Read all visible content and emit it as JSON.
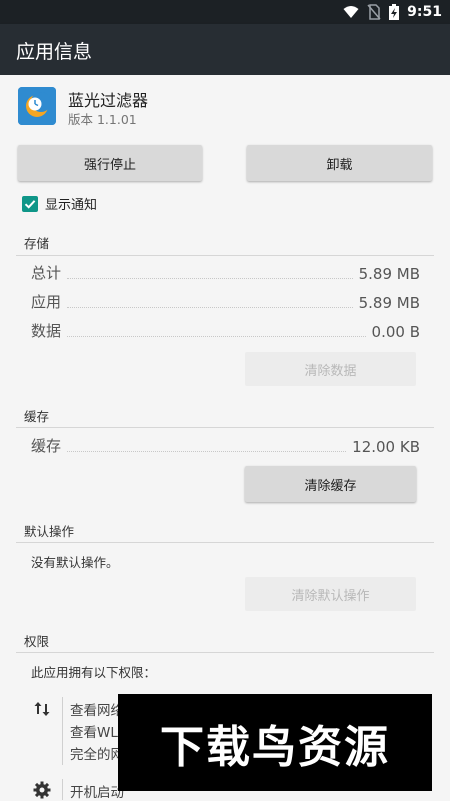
{
  "status_bar": {
    "time": "9:51",
    "icons": [
      "wifi-icon",
      "no-sim-icon",
      "battery-charging-icon"
    ]
  },
  "app_bar": {
    "title": "应用信息"
  },
  "app": {
    "name": "蓝光过滤器",
    "version": "版本 1.1.01",
    "icon": "blue-light-filter-app-icon"
  },
  "actions": {
    "force_stop": "强行停止",
    "uninstall": "卸载"
  },
  "notification": {
    "label": "显示通知",
    "checked": true
  },
  "storage": {
    "header": "存储",
    "rows": [
      {
        "label": "总计",
        "value": "5.89 MB"
      },
      {
        "label": "应用",
        "value": "5.89 MB"
      },
      {
        "label": "数据",
        "value": "0.00 B"
      }
    ],
    "clear_data": "清除数据"
  },
  "cache": {
    "header": "缓存",
    "rows": [
      {
        "label": "缓存",
        "value": "12.00 KB"
      }
    ],
    "clear_cache": "清除缓存"
  },
  "defaults": {
    "header": "默认操作",
    "text": "没有默认操作。",
    "clear_defaults": "清除默认操作"
  },
  "permissions": {
    "header": "权限",
    "intro": "此应用拥有以下权限：",
    "groups": [
      {
        "icon": "network-arrows-icon",
        "lines": [
          "查看网络",
          "查看WL",
          "完全的网"
        ]
      },
      {
        "icon": "gear-icon",
        "lines": [
          "开机启动"
        ]
      }
    ]
  },
  "watermark": {
    "text": "下载鸟资源"
  },
  "colors": {
    "status_bar": "#1c2125",
    "app_bar": "#272d33",
    "background": "#f5f5f5",
    "accent": "#0f9688",
    "button": "#d9d9d9"
  }
}
